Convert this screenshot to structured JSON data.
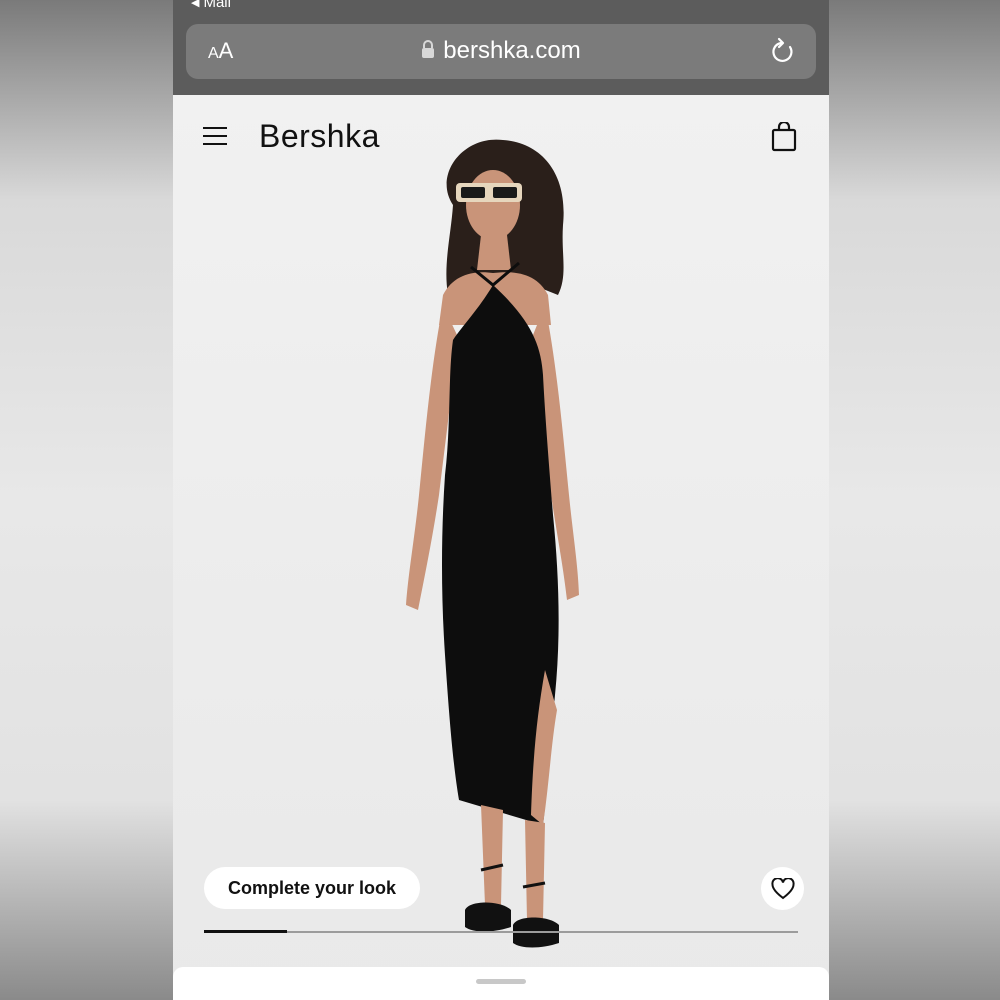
{
  "browser": {
    "back_label": "Mail",
    "text_size_label_small": "A",
    "text_size_label_large": "A",
    "url": "bershka.com"
  },
  "header": {
    "logo": "Bershka"
  },
  "product": {
    "cta_label": "Complete your look",
    "gallery_progress": 0.14
  },
  "colors": {
    "dress": "#0d0d0d",
    "skin": "#c99479",
    "hair": "#2a1f1a",
    "browser_bar": "#5c5c5c"
  },
  "icons": {
    "menu": "hamburger-menu-icon",
    "bag": "shopping-bag-icon",
    "lock": "lock-icon",
    "reload": "reload-icon",
    "favorite": "heart-icon"
  }
}
